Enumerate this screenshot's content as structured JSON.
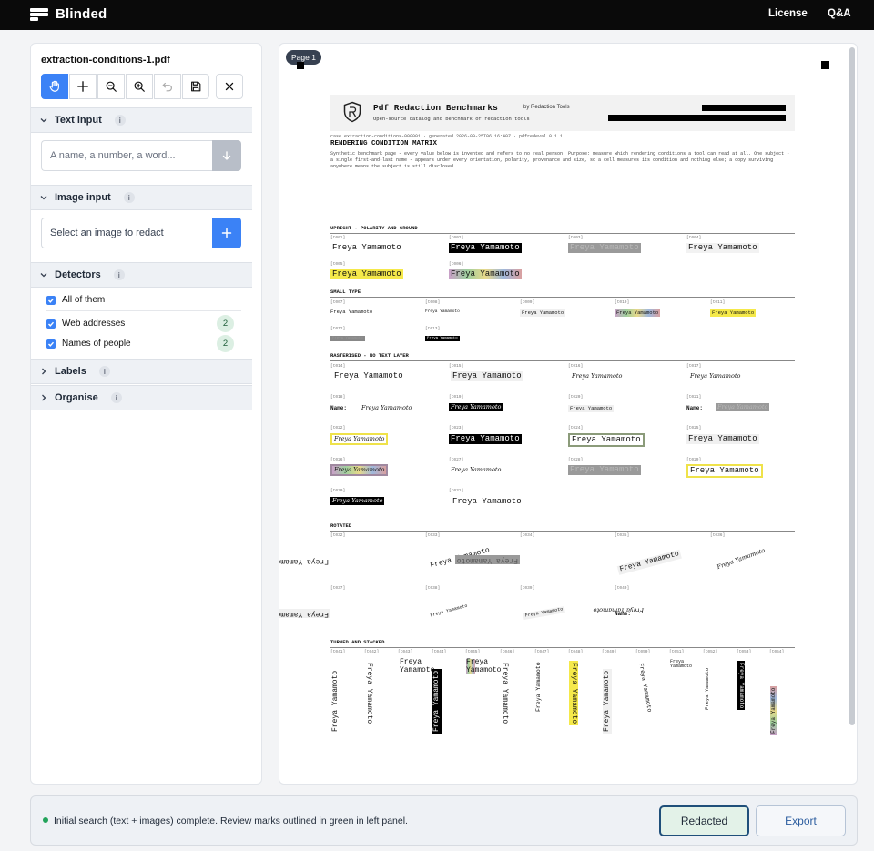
{
  "app": {
    "brand": "Blinded",
    "nav": [
      "License",
      "Q&A"
    ]
  },
  "sidebar": {
    "file_name": "extraction-conditions-1.pdf",
    "toolbar": [
      {
        "name": "pan-tool-button",
        "icon": "hand-icon",
        "active": true
      },
      {
        "name": "add-mark-button",
        "icon": "plus-icon"
      },
      {
        "name": "zoom-out-button",
        "icon": "zoom-out-icon"
      },
      {
        "name": "zoom-in-button",
        "icon": "zoom-in-icon"
      },
      {
        "name": "undo-button",
        "icon": "undo-icon",
        "disabled": true
      },
      {
        "name": "save-button",
        "icon": "save-icon"
      },
      {
        "name": "close-button",
        "icon": "close-icon"
      }
    ],
    "text_input": {
      "title": "Text input",
      "placeholder": "A name, a number, a word..."
    },
    "image_input": {
      "title": "Image input",
      "placeholder": "Select an image to redact"
    },
    "detectors": {
      "title": "Detectors",
      "all_label": "All of them",
      "items": [
        {
          "label": "Web addresses",
          "count": "2"
        },
        {
          "label": "Names of people",
          "count": "2"
        }
      ]
    },
    "labels": {
      "title": "Labels"
    },
    "organise": {
      "title": "Organise"
    }
  },
  "viewer": {
    "page_label": "Page 1",
    "doc": {
      "title": "Pdf Redaction Benchmarks",
      "by": "by Redaction Tools",
      "subtitle": "Open-source catalog and benchmark of redaction tools",
      "meta": "case extraction-conditions-000001   ·   generated 2026-09-25T06:16:40Z   ·   pdfredeval 0.1.1",
      "heading": "RENDERING CONDITION MATRIX",
      "description": "Synthetic benchmark page - every value below is invented and refers to no real person. Purpose: measure which rendering conditions a tool can read at all. One subject - a single first-and-last name - appears under every orientation, polarity, provenance and size, so a cell measures its condition and nothing else; a copy surviving anywhere means the subject is still disclosed.",
      "sample_name": "Freya Yamamoto",
      "name_label": "Name:",
      "sections": [
        "UPRIGHT - POLARITY AND GROUND",
        "SMALL TYPE",
        "RASTERISED - NO TEXT LAYER",
        "ROTATED",
        "TURNED AND STACKED"
      ],
      "ids": [
        "[t001]",
        "[t002]",
        "[t003]",
        "[t004]",
        "[t005]",
        "[t006]",
        "[t007]",
        "[t008]",
        "[t009]",
        "[t010]",
        "[t011]",
        "[t012]",
        "[t013]",
        "[t014]",
        "[t015]",
        "[t016]",
        "[t017]",
        "[t018]",
        "[t019]",
        "[t020]",
        "[t021]",
        "[t022]",
        "[t023]",
        "[t024]",
        "[t025]",
        "[t026]",
        "[t027]",
        "[t028]",
        "[t029]",
        "[t030]",
        "[t031]",
        "[t032]",
        "[t033]",
        "[t034]",
        "[t035]",
        "[t036]",
        "[t037]",
        "[t038]",
        "[t039]",
        "[t040]",
        "[t041]",
        "[t042]",
        "[t043]",
        "[t044]",
        "[t045]",
        "[t046]",
        "[t047]",
        "[t048]",
        "[t049]",
        "[t050]",
        "[t051]",
        "[t052]",
        "[t053]",
        "[t054]"
      ]
    }
  },
  "status": {
    "message": "Initial search (text + images) complete. Review marks outlined in green in left panel.",
    "redacted_label": "Redacted",
    "export_label": "Export"
  }
}
